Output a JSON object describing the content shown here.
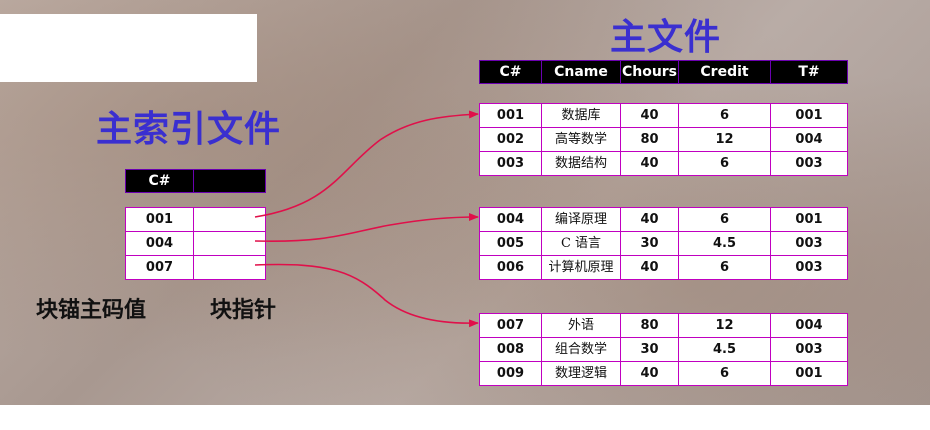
{
  "main_title": "主文件",
  "index_title": "主索引文件",
  "captions": {
    "anchor_key": "块锚主码值",
    "block_pointer": "块指针"
  },
  "main_file": {
    "columns": [
      "C#",
      "Cname",
      "Chours",
      "Credit",
      "T#"
    ],
    "blocks": [
      {
        "rows": [
          [
            "001",
            "数据库",
            "40",
            "6",
            "001"
          ],
          [
            "002",
            "高等数学",
            "80",
            "12",
            "004"
          ],
          [
            "003",
            "数据结构",
            "40",
            "6",
            "003"
          ]
        ]
      },
      {
        "rows": [
          [
            "004",
            "编译原理",
            "40",
            "6",
            "001"
          ],
          [
            "005",
            "C 语言",
            "30",
            "4.5",
            "003"
          ],
          [
            "006",
            "计算机原理",
            "40",
            "6",
            "003"
          ]
        ]
      },
      {
        "rows": [
          [
            "007",
            "外语",
            "80",
            "12",
            "004"
          ],
          [
            "008",
            "组合数学",
            "30",
            "4.5",
            "003"
          ],
          [
            "009",
            "数理逻辑",
            "40",
            "6",
            "001"
          ]
        ]
      }
    ]
  },
  "index_file": {
    "columns": [
      "C#",
      ""
    ],
    "rows": [
      {
        "key": "001",
        "pointer": ""
      },
      {
        "key": "004",
        "pointer": ""
      },
      {
        "key": "007",
        "pointer": ""
      }
    ]
  },
  "colors": {
    "title": "#3a2fd0",
    "arrow": "#e0104a",
    "table_border": "#c000c0"
  }
}
